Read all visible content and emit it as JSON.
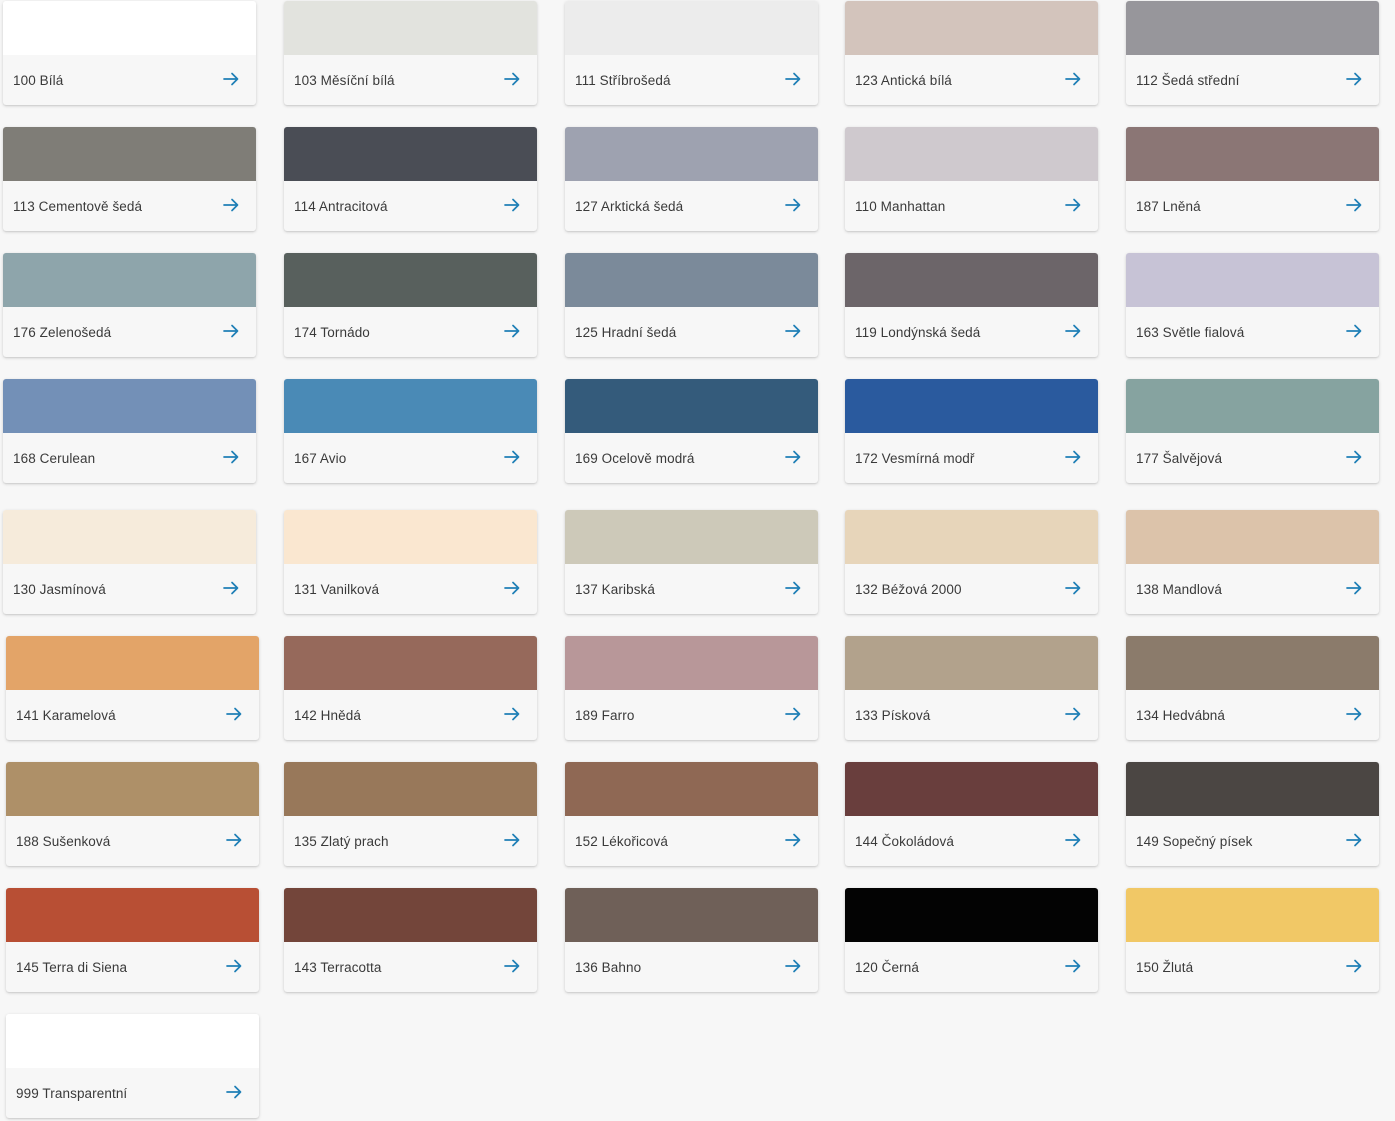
{
  "icons": {
    "arrow": "arrow-right-icon"
  },
  "accent_color": "#1f7fb6",
  "colors": [
    {
      "label": "100 Bílá",
      "hex": "#ffffff"
    },
    {
      "label": "103 Měsíční bílá",
      "hex": "#e2e3de"
    },
    {
      "label": "111 Stříbrošedá",
      "hex": "#ececec"
    },
    {
      "label": "123 Antická bílá",
      "hex": "#d3c4bc"
    },
    {
      "label": "112 Šedá střední",
      "hex": "#97969b"
    },
    {
      "label": "113 Cementově šedá",
      "hex": "#7f7d77"
    },
    {
      "label": "114 Antracitová",
      "hex": "#4a4d55"
    },
    {
      "label": "127 Arktická šedá",
      "hex": "#9ea2b0"
    },
    {
      "label": "110 Manhattan",
      "hex": "#cfc9ce"
    },
    {
      "label": "187 Lněná",
      "hex": "#8b7675"
    },
    {
      "label": "176 Zelenošedá",
      "hex": "#8ea5ab"
    },
    {
      "label": "174 Tornádo",
      "hex": "#58605d"
    },
    {
      "label": "125 Hradní šedá",
      "hex": "#7b8a9a"
    },
    {
      "label": "119 Londýnská šedá",
      "hex": "#6c6569"
    },
    {
      "label": "163 Světle fialová",
      "hex": "#c7c3d6"
    },
    {
      "label": "168 Cerulean",
      "hex": "#7390b7"
    },
    {
      "label": "167 Avio",
      "hex": "#4a8ab6"
    },
    {
      "label": "169 Ocelově modrá",
      "hex": "#345b7b"
    },
    {
      "label": "172 Vesmírná modř",
      "hex": "#2a5a9e"
    },
    {
      "label": "177 Šalvějová",
      "hex": "#86a3a0"
    },
    {
      "label": "130 Jasmínová",
      "hex": "#f6ebdb"
    },
    {
      "label": "131 Vanilková",
      "hex": "#fae7d0"
    },
    {
      "label": "137 Karibská",
      "hex": "#cdc9b9"
    },
    {
      "label": "132 Béžová 2000",
      "hex": "#e7d5ba"
    },
    {
      "label": "138 Mandlová",
      "hex": "#dcc3aa"
    },
    {
      "label": "141 Karamelová",
      "hex": "#e3a468"
    },
    {
      "label": "142 Hnědá",
      "hex": "#96695b"
    },
    {
      "label": "189 Farro",
      "hex": "#b89799"
    },
    {
      "label": "133 Písková",
      "hex": "#b2a28c"
    },
    {
      "label": "134 Hedvábná",
      "hex": "#8b7b6b"
    },
    {
      "label": "188 Sušenková",
      "hex": "#ae9068"
    },
    {
      "label": "135 Zlatý prach",
      "hex": "#98785a"
    },
    {
      "label": "152 Lékořicová",
      "hex": "#8f6854"
    },
    {
      "label": "144 Čokoládová",
      "hex": "#693e3d"
    },
    {
      "label": "149 Sopečný písek",
      "hex": "#4b4643"
    },
    {
      "label": "145 Terra di Siena",
      "hex": "#b84f34"
    },
    {
      "label": "143 Terracotta",
      "hex": "#73453a"
    },
    {
      "label": "136 Bahno",
      "hex": "#6f6058"
    },
    {
      "label": "120 Černá",
      "hex": "#030303"
    },
    {
      "label": "150 Žlutá",
      "hex": "#f1c866"
    },
    {
      "label": "999 Transparentní",
      "hex": "#ffffff"
    }
  ]
}
